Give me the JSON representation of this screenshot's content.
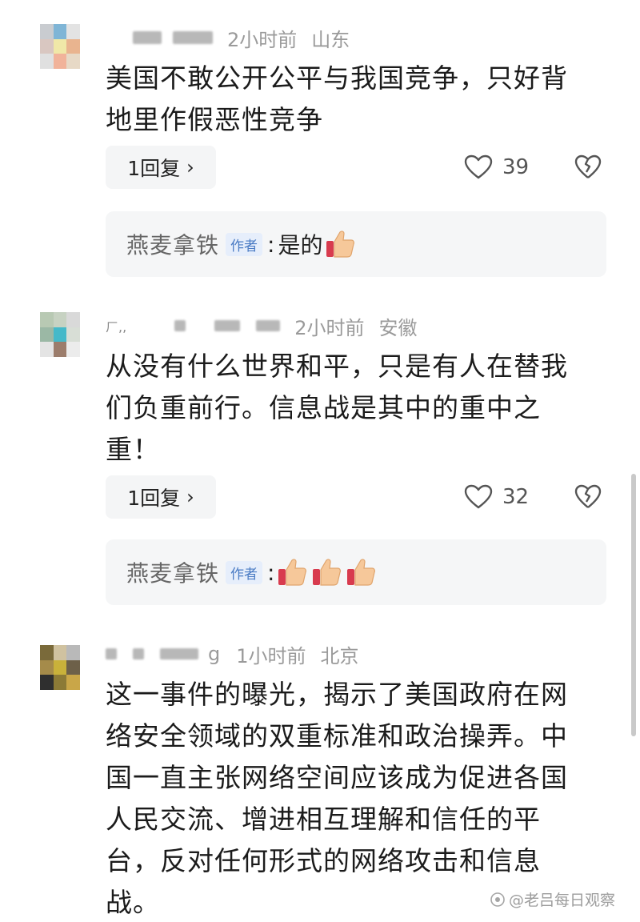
{
  "comments": [
    {
      "time": "2小时前",
      "location": "山东",
      "text_lines": [
        "美国不敢公开公平与我国竞争，只好背",
        "地里作假恶性竞争"
      ],
      "reply_label": "1回复",
      "like_count": "39",
      "author_reply": {
        "name": "燕麦拿铁",
        "tag": "作者",
        "colon": ":",
        "text": "是的",
        "emoji_count": 1
      }
    },
    {
      "time": "2小时前",
      "location": "安徽",
      "name_fragment": "ㄏ,,",
      "text_lines": [
        "从没有什么世界和平，只是有人在替我",
        "们负重前行。信息战是其中的重中之",
        "重！"
      ],
      "reply_label": "1回复",
      "like_count": "32",
      "author_reply": {
        "name": "燕麦拿铁",
        "tag": "作者",
        "colon": ":",
        "text": "",
        "emoji_count": 3
      }
    },
    {
      "time": "1小时前",
      "location": "北京",
      "name_fragment": "g",
      "text_lines": [
        "这一事件的曝光，揭示了美国政府在网",
        "络安全领域的双重标准和政治操弄。中",
        "国一直主张网络空间应该成为促进各国",
        "人民交流、增进相互理解和信任的平",
        "台，反对任何形式的网络攻击和信息",
        "战。"
      ]
    }
  ],
  "icons": {
    "like": "heart-outline-icon",
    "dislike": "broken-heart-icon",
    "reply_chevron": "chevron-right-icon",
    "author_emoji": "thumbs-up-icon"
  },
  "reply_chevron": "›",
  "watermark": "@老吕每日观察",
  "colors": {
    "meta": "#9a9a9a",
    "pill_bg": "#f4f5f6",
    "author_tag": "#4b7cc4"
  }
}
